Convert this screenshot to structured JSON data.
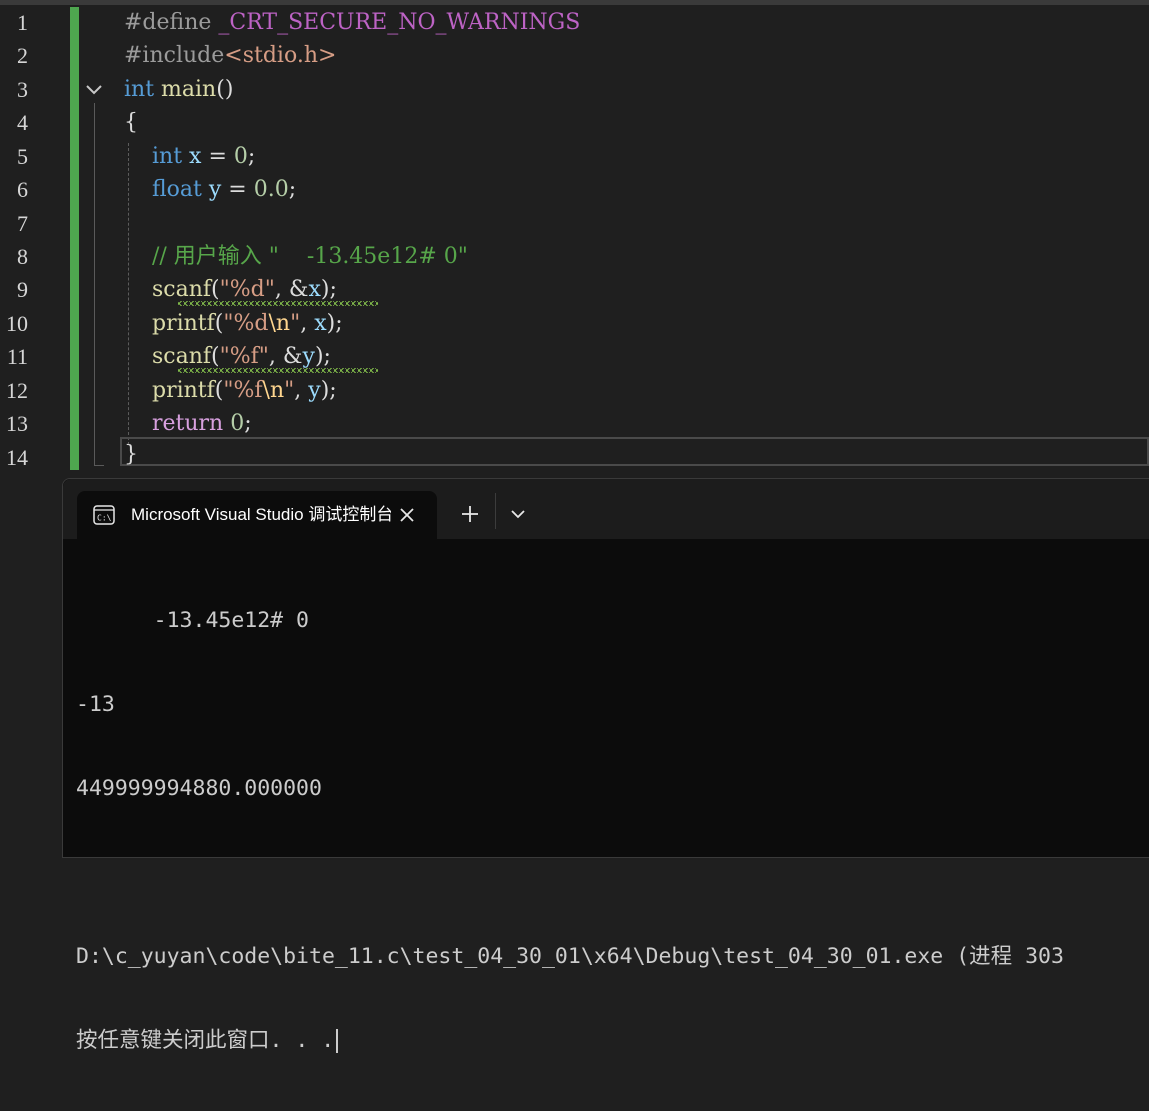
{
  "editor": {
    "line_numbers": [
      "1",
      "2",
      "3",
      "4",
      "5",
      "6",
      "7",
      "8",
      "9",
      "10",
      "11",
      "12",
      "13",
      "14"
    ],
    "code": {
      "l1_directive": "#define",
      "l1_macro": "_CRT_SECURE_NO_WARNINGS",
      "l2_directive": "#include",
      "l2_header": "<stdio.h>",
      "l3_type": "int",
      "l3_func": "main",
      "l3_parens": "()",
      "l4_brace": "{",
      "l5_type": "int",
      "l5_var": "x",
      "l5_eq": " = ",
      "l5_num": "0",
      "l5_semi": ";",
      "l6_type": "float",
      "l6_var": "y",
      "l6_eq": " = ",
      "l6_num": "0.0",
      "l6_semi": ";",
      "l8_comment": "// 用户输入 \"    -13.45e12# 0\"",
      "l9_func": "scanf",
      "l9_open": "(",
      "l9_str": "\"%d\"",
      "l9_mid": ", &",
      "l9_var": "x",
      "l9_close": ");",
      "l10_func": "printf",
      "l10_open": "(",
      "l10_str1": "\"%d",
      "l10_esc": "\\n",
      "l10_str2": "\"",
      "l10_mid": ", ",
      "l10_var": "x",
      "l10_close": ");",
      "l11_func": "scanf",
      "l11_open": "(",
      "l11_str": "\"%f\"",
      "l11_mid": ", &",
      "l11_var": "y",
      "l11_close": ");",
      "l12_func": "printf",
      "l12_open": "(",
      "l12_str1": "\"%f",
      "l12_esc": "\\n",
      "l12_str2": "\"",
      "l12_mid": ", ",
      "l12_var": "y",
      "l12_close": ");",
      "l13_kw": "return",
      "l13_num": "0",
      "l13_semi": ";",
      "l14_brace": "}"
    }
  },
  "terminal": {
    "tab_title": "Microsoft Visual Studio 调试控制台",
    "tab_icon": "console-icon",
    "close_icon": "close-icon",
    "new_tab_icon": "plus-icon",
    "dropdown_icon": "chevron-down-icon",
    "output": [
      "      -13.45e12# 0",
      "-13",
      "449999994880.000000",
      "",
      "D:\\c_yuyan\\code\\bite_11.c\\test_04_30_01\\x64\\Debug\\test_04_30_01.exe (进程 303",
      "按任意键关闭此窗口. . ."
    ]
  },
  "colors": {
    "editor_bg": "#1f1f1f",
    "change_bar": "#4ea64f",
    "keyword": "#569cd6",
    "function": "#dcdcaa",
    "variable": "#9cdcfe",
    "number": "#b5cea8",
    "comment": "#57a64a",
    "string": "#d69d85",
    "terminal_bg": "#0c0c0c"
  }
}
